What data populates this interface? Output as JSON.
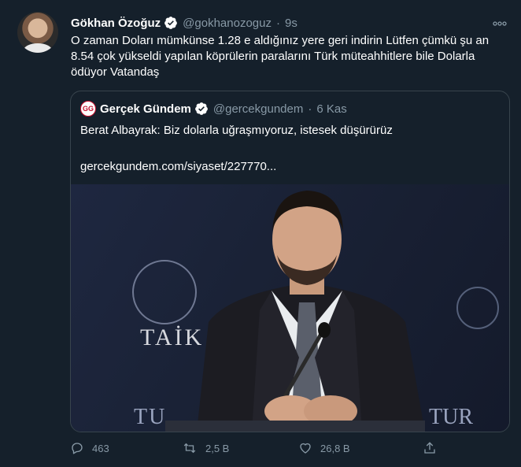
{
  "tweet": {
    "author_name": "Gökhan Özoğuz",
    "author_handle": "@gokhanozoguz",
    "separator": "·",
    "time": "9s",
    "text": "O zaman Doları mümkünse 1.28 e aldığınız yere geri indirin Lütfen çümkü şu an 8.54 çok yükseldi yapılan köprülerin paralarını Türk müteahhitlere bile Dolarla ödüyor Vatandaş",
    "more_icon": "more-icon",
    "verified_color": "#ffffff"
  },
  "quote": {
    "logo_text": "GG",
    "author_name": "Gerçek Gündem",
    "author_handle": "@gercekgundem",
    "separator": "·",
    "time": "6 Kas",
    "text": "Berat Albayrak: Biz dolarla uğraşmıyoruz, istesek düşürürüz",
    "link": "gercekgundem.com/siyaset/227770...",
    "image_text_sign": "TAİK",
    "image_text_bottom_left": "TU",
    "image_text_bottom_right": "TUR"
  },
  "actions": {
    "reply_count": "463",
    "retweet_count": "2,5 B",
    "like_count": "26,8 B",
    "icons": [
      "reply-icon",
      "retweet-icon",
      "like-icon",
      "share-icon"
    ]
  },
  "colors": {
    "background": "#15202b",
    "muted": "#8899a6",
    "border": "#38444d"
  }
}
